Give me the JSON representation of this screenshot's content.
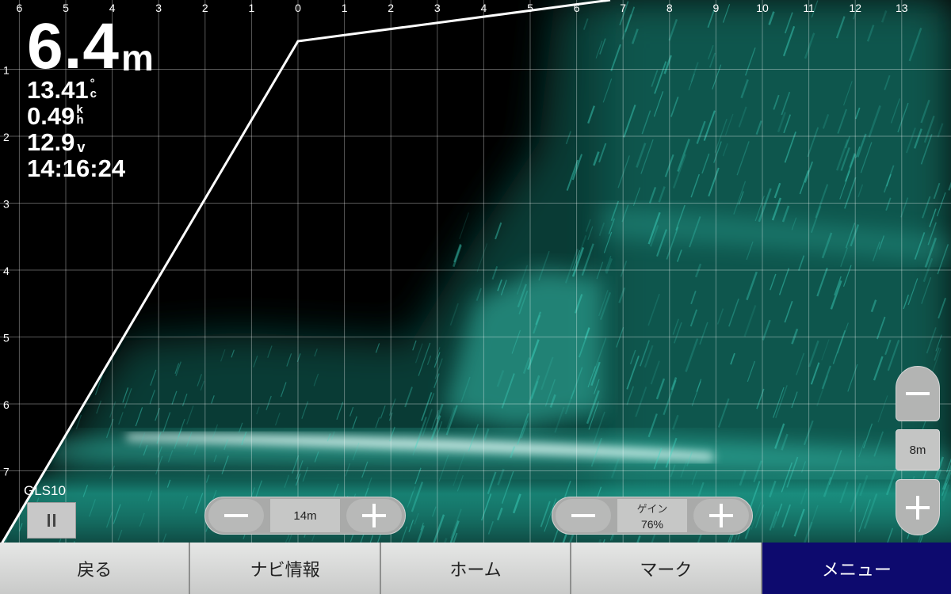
{
  "readout": {
    "depth_value": "6.4",
    "depth_unit": "m",
    "water_temp": "13.41",
    "temp_unit_top": "°",
    "temp_unit_bottom": "c",
    "speed": "0.49",
    "speed_unit_top": "k",
    "speed_unit_bottom": "h",
    "voltage": "12.9",
    "voltage_unit": "v",
    "time": "14:16:24"
  },
  "axis": {
    "top_ticks": [
      "6",
      "5",
      "4",
      "3",
      "2",
      "1",
      "0",
      "1",
      "2",
      "3",
      "4",
      "5",
      "6",
      "7",
      "8",
      "9",
      "10",
      "11",
      "12",
      "13"
    ],
    "left_ticks": [
      "1",
      "2",
      "3",
      "4",
      "5",
      "6",
      "7"
    ]
  },
  "source_label": "GLS10",
  "range_control": {
    "value": "14m"
  },
  "gain_control": {
    "label": "ゲイン",
    "value": "76%"
  },
  "zoom_control": {
    "value": "8m"
  },
  "navbar": {
    "back": "戻る",
    "navi_info": "ナビ情報",
    "home": "ホーム",
    "mark": "マーク",
    "menu": "メニュー"
  },
  "colors": {
    "echo": "#3fd9c4",
    "menu_active": "#0d0a6e"
  }
}
